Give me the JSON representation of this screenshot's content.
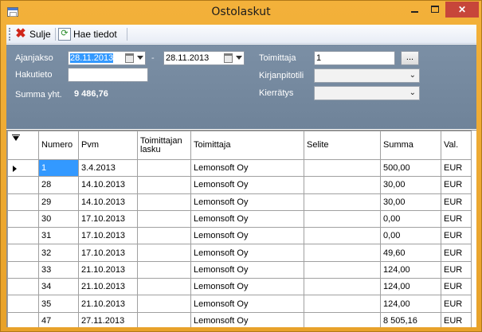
{
  "window": {
    "title": "Ostolaskut",
    "close_glyph": "✕"
  },
  "toolbar": {
    "close_label": "Sulje",
    "fetch_label": "Hae tiedot"
  },
  "filters": {
    "period_label": "Ajanjakso",
    "date_from": "28.11.2013",
    "date_sep": "-",
    "date_to": "28.11.2013",
    "search_label": "Hakutieto",
    "search_value": "",
    "sum_label": "Summa yht.",
    "sum_value": "9 486,76",
    "supplier_label": "Toimittaja",
    "supplier_value": "1",
    "supplier_browse": "...",
    "account_label": "Kirjanpitotili",
    "account_value": "",
    "circulation_label": "Kierrätys",
    "circulation_value": ""
  },
  "table": {
    "columns": [
      "Numero",
      "Pvm",
      "Toimittajan lasku",
      "Toimittaja",
      "Selite",
      "Summa",
      "Val."
    ],
    "rows": [
      [
        "1",
        "3.4.2013",
        "",
        "Lemonsoft Oy",
        "",
        "500,00",
        "EUR"
      ],
      [
        "28",
        "14.10.2013",
        "",
        "Lemonsoft Oy",
        "",
        "30,00",
        "EUR"
      ],
      [
        "29",
        "14.10.2013",
        "",
        "Lemonsoft Oy",
        "",
        "30,00",
        "EUR"
      ],
      [
        "30",
        "17.10.2013",
        "",
        "Lemonsoft Oy",
        "",
        "0,00",
        "EUR"
      ],
      [
        "31",
        "17.10.2013",
        "",
        "Lemonsoft Oy",
        "",
        "0,00",
        "EUR"
      ],
      [
        "32",
        "17.10.2013",
        "",
        "Lemonsoft Oy",
        "",
        "49,60",
        "EUR"
      ],
      [
        "33",
        "21.10.2013",
        "",
        "Lemonsoft Oy",
        "",
        "124,00",
        "EUR"
      ],
      [
        "34",
        "21.10.2013",
        "",
        "Lemonsoft Oy",
        "",
        "124,00",
        "EUR"
      ],
      [
        "35",
        "21.10.2013",
        "",
        "Lemonsoft Oy",
        "",
        "124,00",
        "EUR"
      ],
      [
        "47",
        "27.11.2013",
        "",
        "Lemonsoft Oy",
        "",
        "8 505,16",
        "EUR"
      ]
    ]
  }
}
